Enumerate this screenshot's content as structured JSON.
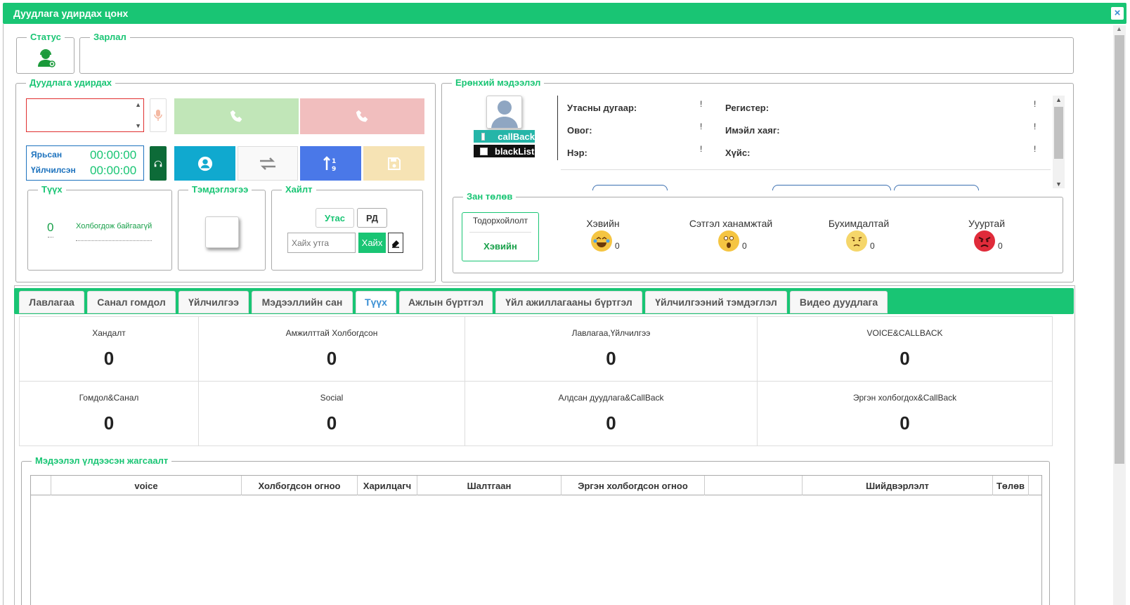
{
  "window": {
    "title": "Дуудлага удирдах цонх",
    "close_label": "×"
  },
  "status": {
    "legend": "Статус"
  },
  "notice": {
    "legend": "Зарлал"
  },
  "call_control": {
    "legend": "Дуудлага удирдах",
    "answered_label": "Ярьсан",
    "answered_time": "00:00:00",
    "served_label": "Үйлчилсэн",
    "served_time": "00:00:00",
    "colors": {
      "accept": "#c1e6b8",
      "reject": "#f1bebe",
      "profile": "#10a9cf",
      "swap": "#f9f9f9",
      "sort": "#4a78e8",
      "save": "#f6e3b4"
    }
  },
  "history": {
    "legend": "Түүх",
    "count": "0",
    "status_text": "Холбогдож байгаагүй"
  },
  "note": {
    "legend": "Тэмдэглэгээ"
  },
  "search": {
    "legend": "Хайлт",
    "phone_btn": "Утас",
    "rd_btn": "РД",
    "placeholder": "Хайх утга",
    "search_btn": "Хайх"
  },
  "general": {
    "legend": "Ерөнхий мэдээлэл",
    "callback_label": "callBack",
    "blacklist_label": "blackList",
    "fields": {
      "phone": "Утасны дугаар:",
      "register": "Регистер:",
      "surname": "Овог:",
      "email": "Имэйл хаяг:",
      "name": "Нэр:",
      "gender": "Хүйс:"
    },
    "bang": "!"
  },
  "mood": {
    "legend": "Зан төлөв",
    "unknown_label": "Тодорхойлолт",
    "unknown_value": "Хэвийн",
    "items": [
      {
        "label": "Хэвийн",
        "count": "0",
        "color": "#f5c542"
      },
      {
        "label": "Сэтгэл ханамжтай",
        "count": "0",
        "color": "#f5c542"
      },
      {
        "label": "Бухимдалтай",
        "count": "0",
        "color": "#f5d66a"
      },
      {
        "label": "Уууртай",
        "count": "0",
        "color": "#e02b3a"
      }
    ]
  },
  "tabs": [
    "Лавлагаа",
    "Санал гомдол",
    "Үйлчилгээ",
    "Мэдээллийн сан",
    "Түүх",
    "Ажлын бүртгэл",
    "Үйл ажиллагааны бүртгэл",
    "Үйлчилгээний тэмдэглэл",
    "Видео дуудлага"
  ],
  "active_tab": "Түүх",
  "stats": [
    {
      "label": "Хандалт",
      "value": "0"
    },
    {
      "label": "Амжилттай Холбогдсон",
      "value": "0"
    },
    {
      "label": "Лавлагаа,Үйлчилгээ",
      "value": "0"
    },
    {
      "label": "VOICE&CALLBACK",
      "value": "0"
    },
    {
      "label": "Гомдол&Санал",
      "value": "0"
    },
    {
      "label": "Social",
      "value": "0"
    },
    {
      "label": "Алдсан дуудлага&CallBack",
      "value": "0"
    },
    {
      "label": "Эргэн холбогдох&CallBack",
      "value": "0"
    }
  ],
  "table": {
    "legend": "Мэдээлэл үлдээсэн жагсаалт",
    "headers": [
      "",
      "voice",
      "Холбогдсон огноо",
      "Харилцагч",
      "Шалтгаан",
      "Эргэн холбогдсон огноо",
      "",
      "Шийдвэрлэлт",
      "Төлөв"
    ]
  }
}
